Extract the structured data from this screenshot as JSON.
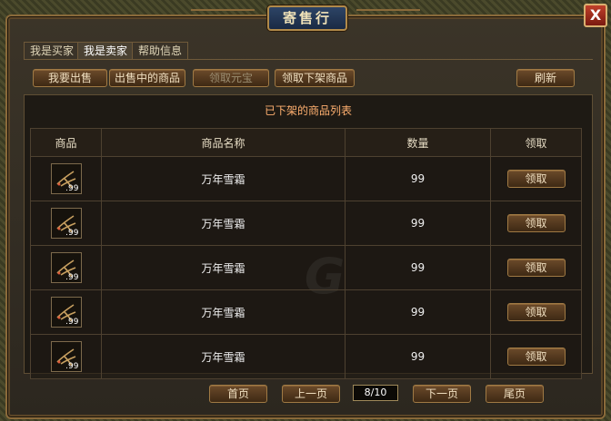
{
  "window": {
    "title": "寄售行",
    "close_symbol": "X"
  },
  "tabs": [
    {
      "label": "我是买家"
    },
    {
      "label": "我是卖家"
    },
    {
      "label": "帮助信息"
    }
  ],
  "toolbar": {
    "sell_label": "我要出售",
    "on_sale_label": "出售中的商品",
    "claim_ingot_label": "领取元宝",
    "claim_removed_label": "领取下架商品",
    "refresh_label": "刷新"
  },
  "list": {
    "caption": "已下架的商品列表",
    "headers": {
      "item": "商品",
      "name": "商品名称",
      "quantity": "数量",
      "action": "领取"
    },
    "rows": [
      {
        "name": "万年雪霜",
        "quantity": "99",
        "stack": ".99",
        "action": "领取"
      },
      {
        "name": "万年雪霜",
        "quantity": "99",
        "stack": ".99",
        "action": "领取"
      },
      {
        "name": "万年雪霜",
        "quantity": "99",
        "stack": ".99",
        "action": "领取"
      },
      {
        "name": "万年雪霜",
        "quantity": "99",
        "stack": ".99",
        "action": "领取"
      },
      {
        "name": "万年雪霜",
        "quantity": "99",
        "stack": ".99",
        "action": "领取"
      }
    ]
  },
  "pagination": {
    "first_label": "首页",
    "prev_label": "上一页",
    "page_indicator": "8/10",
    "next_label": "下一页",
    "last_label": "尾页"
  },
  "colors": {
    "accent": "#a07a44",
    "caption": "#ffb070",
    "title_plate": "#1a2a44"
  }
}
